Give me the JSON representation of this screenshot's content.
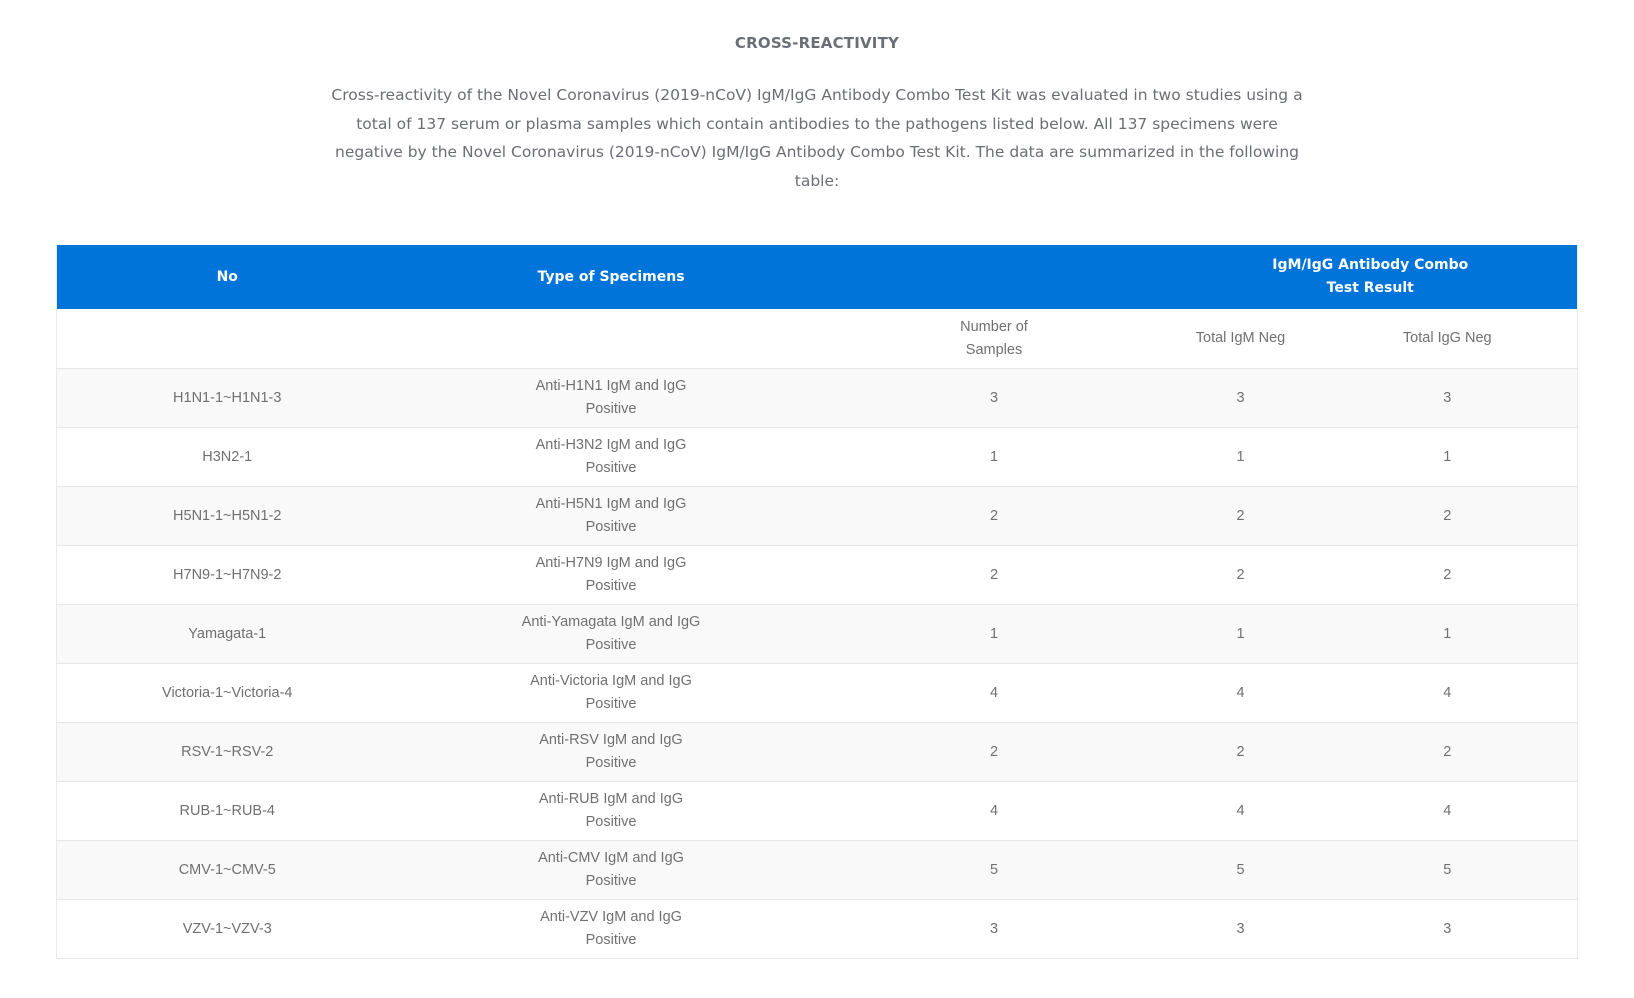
{
  "section": {
    "title": "CROSS-REACTIVITY",
    "intro": "Cross-reactivity of the  Novel Coronavirus (2019-nCoV) IgM/IgG Antibody Combo Test Kit was evaluated in two studies using a total of 137 serum or plasma samples which contain antibodies to the pathogens listed below. All 137 specimens were negative by the  Novel Coronavirus (2019-nCoV) IgM/IgG Antibody Combo Test Kit. The data are summarized in the following table:"
  },
  "table": {
    "header": {
      "no": "No",
      "type": "Type of Specimens",
      "result_line1": "IgM/IgG Antibody Combo",
      "result_line2": "Test Result"
    },
    "subheader": {
      "samples_line1": "Number of",
      "samples_line2": "Samples",
      "igm": "Total IgM Neg",
      "igg": "Total IgG Neg"
    },
    "rows": [
      {
        "no": "H1N1-1~H1N1-3",
        "type_line1": "Anti-H1N1 IgM and IgG",
        "type_line2": "Positive",
        "samples": "3",
        "igm": "3",
        "igg": "3"
      },
      {
        "no": "H3N2-1",
        "type_line1": "Anti-H3N2 IgM and IgG",
        "type_line2": "Positive",
        "samples": "1",
        "igm": "1",
        "igg": "1"
      },
      {
        "no": "H5N1-1~H5N1-2",
        "type_line1": "Anti-H5N1 IgM and IgG",
        "type_line2": "Positive",
        "samples": "2",
        "igm": "2",
        "igg": "2"
      },
      {
        "no": "H7N9-1~H7N9-2",
        "type_line1": "Anti-H7N9 IgM and IgG",
        "type_line2": "Positive",
        "samples": "2",
        "igm": "2",
        "igg": "2"
      },
      {
        "no": "Yamagata-1",
        "type_line1": "Anti-Yamagata IgM and IgG",
        "type_line2": "Positive",
        "samples": "1",
        "igm": "1",
        "igg": "1"
      },
      {
        "no": "Victoria-1~Victoria-4",
        "type_line1": "Anti-Victoria IgM and IgG",
        "type_line2": "Positive",
        "samples": "4",
        "igm": "4",
        "igg": "4"
      },
      {
        "no": "RSV-1~RSV-2",
        "type_line1": "Anti-RSV IgM and IgG",
        "type_line2": "Positive",
        "samples": "2",
        "igm": "2",
        "igg": "2"
      },
      {
        "no": "RUB-1~RUB-4",
        "type_line1": "Anti-RUB IgM and IgG",
        "type_line2": "Positive",
        "samples": "4",
        "igm": "4",
        "igg": "4"
      },
      {
        "no": "CMV-1~CMV-5",
        "type_line1": "Anti-CMV IgM and IgG",
        "type_line2": "Positive",
        "samples": "5",
        "igm": "5",
        "igg": "5"
      },
      {
        "no": "VZV-1~VZV-3",
        "type_line1": "Anti-VZV IgM and IgG",
        "type_line2": "Positive",
        "samples": "3",
        "igm": "3",
        "igg": "3"
      }
    ]
  },
  "colors": {
    "header_bg": "#0074d9",
    "header_text": "#ffffff",
    "body_text": "#707070",
    "stripe": "#f9f9f9",
    "border": "#e6e6e6"
  }
}
